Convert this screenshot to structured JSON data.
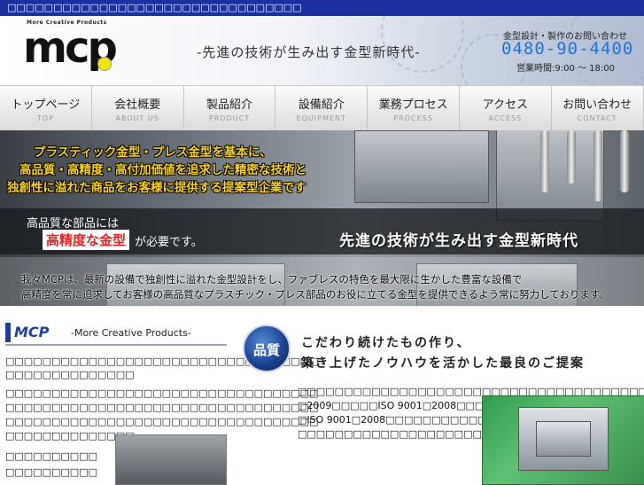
{
  "topbar": {
    "text": "□□□□□□□□□□□□□□□□□□□□□□□□□□□□□□□□"
  },
  "header": {
    "logo_sub": "More Creative Products",
    "logo": "mcp",
    "tagline": "-先進の技術が生み出す金型新時代-",
    "contact_label": "金型設計・製作のお問い合わせ",
    "phone": "0480-90-4400",
    "hours": "営業時間:9:00 〜 18:00"
  },
  "nav": [
    {
      "jp": "トップページ",
      "en": "TOP"
    },
    {
      "jp": "会社概要",
      "en": "ABOUT US"
    },
    {
      "jp": "製品紹介",
      "en": "PRODUCT"
    },
    {
      "jp": "設備紹介",
      "en": "EQUIPMENT"
    },
    {
      "jp": "業務プロセス",
      "en": "PROCESS"
    },
    {
      "jp": "アクセス",
      "en": "ACCESS"
    },
    {
      "jp": "お問い合わせ",
      "en": "CONTACT"
    }
  ],
  "hero": {
    "line1": "プラスティック金型・プレス金型を基本に、",
    "line2": "高品質・高精度・高付加価値を追求した精密な技術と",
    "line3": "独創性に溢れた商品をお客様に提供する提案型企業です",
    "band_left1": "高品質な部品には",
    "band_highlight": "高精度な金型",
    "band_left2": "が必要です。",
    "band_right": "先進の技術が生み出す金型新時代",
    "desc1": "我々MCPは、最新の設備で独創性に溢れた金型設計をし、ファブレスの特色を最大限に生かした豊富な設備で",
    "desc2": "高精度を常に追求してお客様の高品質なプラスチック・プレス部品のお役に立てる金型を提供できるよう常に努力しております。"
  },
  "left": {
    "mcp": "MCP",
    "sub": "-More Creative Products-",
    "lines": [
      "□□□□□□□□□□□□□□□□□□□□□□□□□□□□□□□□□□",
      "□□□□□□□□□□□□□□",
      "□□□□□□□□□□□□□□□□□□□□□□□□□□□□□□□□□□",
      "□□□□□□□□□□□□□□□□□□□□□□□□□□□□□□□□□□",
      "□□□□□□□□□□□□□□□□□□□□□□□□□□□□□□□□□□",
      "□□□□□□□□□□□□□□",
      "□□□□□□□□□□",
      "□□□□□□□□□□"
    ]
  },
  "right": {
    "badge": "品質",
    "head1": "こだわり続けたもの作り、",
    "head2": "築き上げたノウハウを活かした最良のご提案",
    "lines": [
      "□□□□□□□□□□□□□□□□□□□□□□□□□□□□□□□□□□□□□□□□□",
      "□2009□□□□□ISO 9001□2008□□□□□□□□",
      "□ISO 9001□2008□□□□□□□□□□□□□□□□",
      "□□□□□□□□□□□□□□□□□□□□□□□□□□□□□□"
    ]
  }
}
